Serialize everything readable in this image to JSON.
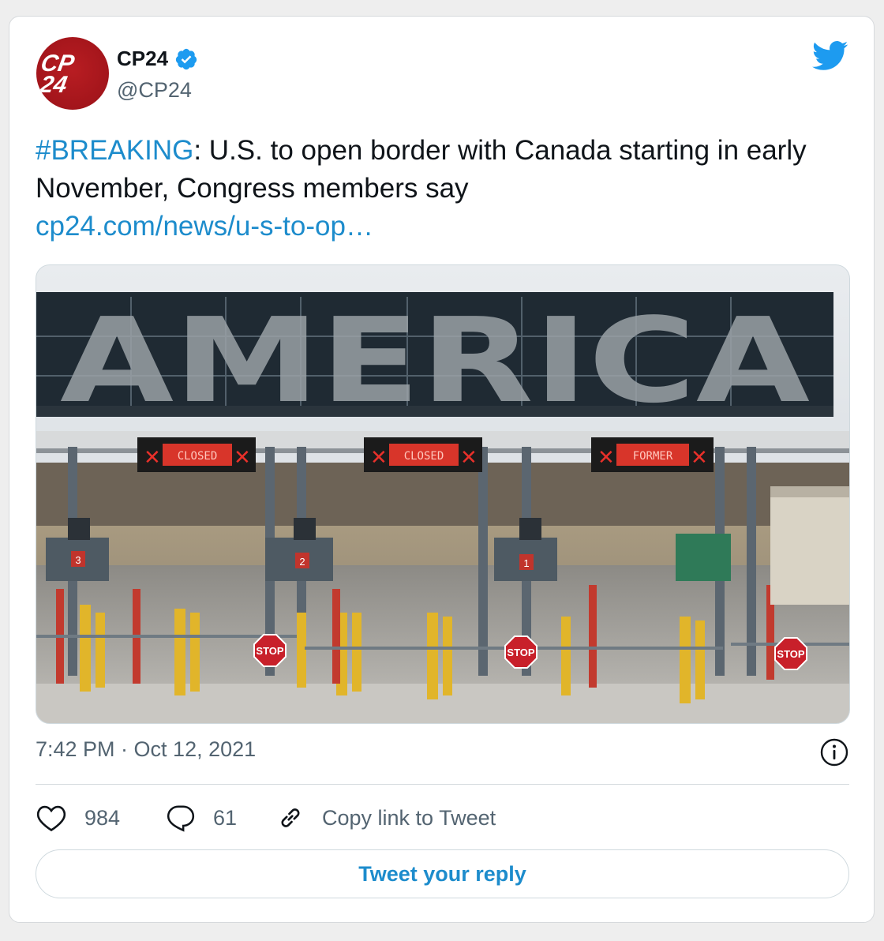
{
  "account": {
    "name": "CP24",
    "handle": "@CP24",
    "logo_text_top": "CP",
    "logo_text_bottom": "24"
  },
  "tweet": {
    "hashtag": "#BREAKING",
    "text": ":  U.S. to open border with Canada starting in early November, Congress members say",
    "link": "cp24.com/news/u-s-to-op…",
    "timestamp": "7:42 PM · Oct 12, 2021"
  },
  "photo": {
    "overhead_sign": "AMERICA",
    "lane_signs": [
      "CLOSED",
      "CLOSED",
      "FORMER"
    ],
    "lane_numbers": [
      "3",
      "2",
      "1"
    ],
    "stop_signs": [
      "STOP",
      "STOP",
      "STOP"
    ]
  },
  "actions": {
    "likes": "984",
    "replies": "61",
    "copy_link": "Copy link to Tweet"
  },
  "reply_button": "Tweet your reply",
  "colors": {
    "twitter_blue": "#1d9bf0",
    "link": "#1d8ccc",
    "brand_red": "#a3151b"
  }
}
